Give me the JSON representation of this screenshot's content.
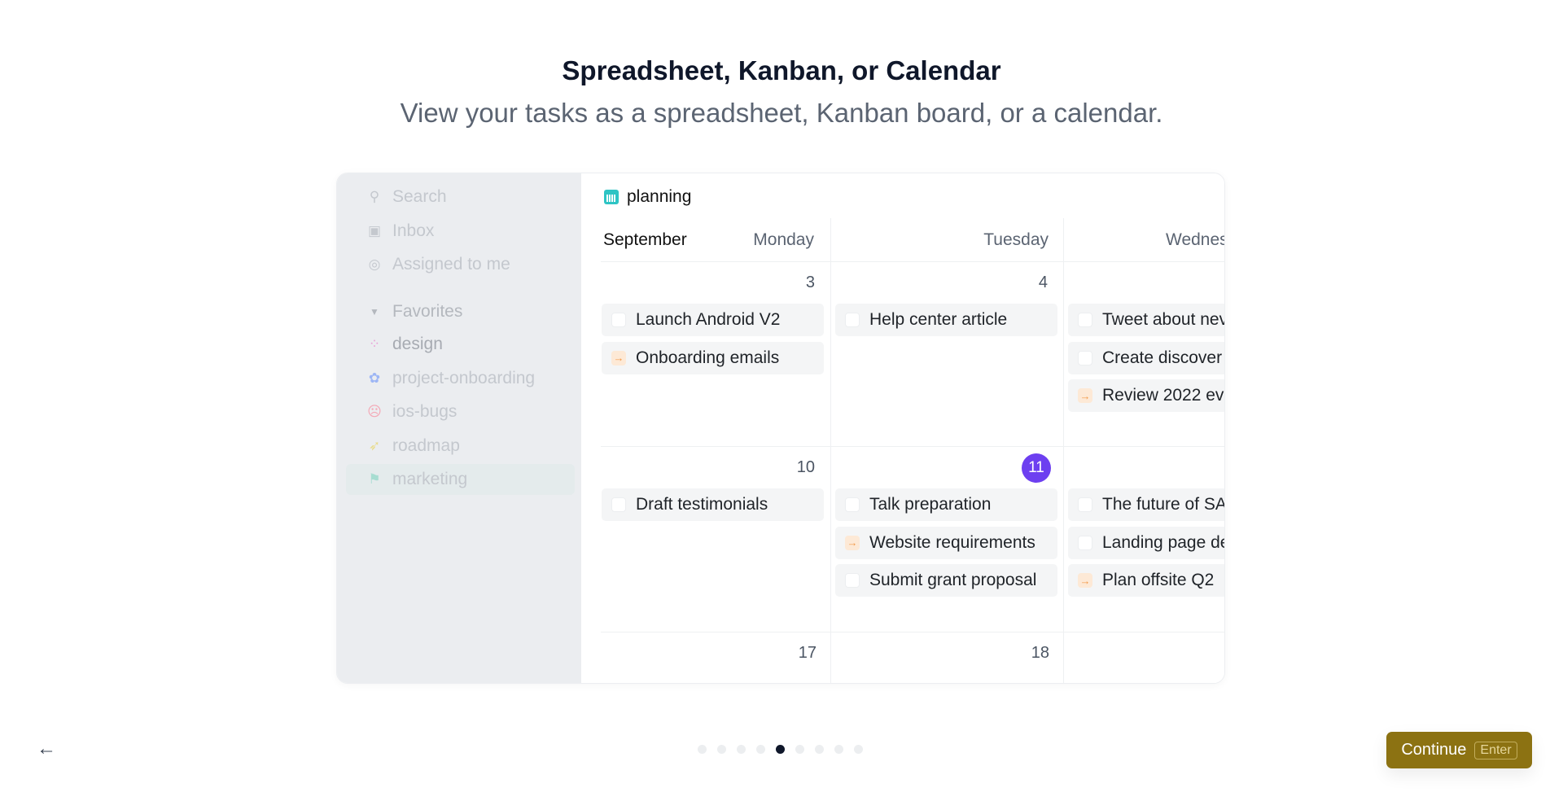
{
  "header": {
    "title": "Spreadsheet, Kanban, or Calendar",
    "subtitle": "View your tasks as a spreadsheet, Kanban board, or a calendar."
  },
  "sidebar": {
    "search": "Search",
    "inbox": "Inbox",
    "assigned": "Assigned to me",
    "favorites": "Favorites",
    "items": [
      {
        "label": "design",
        "icon": "grid-icon",
        "color": "#e9a0d8"
      },
      {
        "label": "project-onboarding",
        "icon": "flower-icon",
        "color": "#9db6f5"
      },
      {
        "label": "ios-bugs",
        "icon": "bug-icon",
        "color": "#f4a7b5"
      },
      {
        "label": "roadmap",
        "icon": "rocket-icon",
        "color": "#e9dc8e"
      },
      {
        "label": "marketing",
        "icon": "flag-icon",
        "color": "#a7ddd1"
      }
    ]
  },
  "calendar": {
    "title": "planning",
    "month": "September",
    "days": [
      "Monday",
      "Tuesday",
      "Wednesd"
    ],
    "weeks": [
      {
        "dates": [
          "3",
          "4",
          ""
        ],
        "tasks": [
          [
            {
              "t": "Launch Android V2",
              "s": "todo"
            },
            {
              "t": "Onboarding emails",
              "s": "progress"
            }
          ],
          [
            {
              "t": "Help center article",
              "s": "todo"
            }
          ],
          [
            {
              "t": "Tweet about nev",
              "s": "todo"
            },
            {
              "t": "Create discover",
              "s": "todo"
            },
            {
              "t": "Review 2022 ev",
              "s": "progress"
            }
          ]
        ]
      },
      {
        "dates": [
          "10",
          "11",
          ""
        ],
        "tasks": [
          [
            {
              "t": "Draft testimonials",
              "s": "todo"
            }
          ],
          [
            {
              "t": "Talk preparation",
              "s": "todo"
            },
            {
              "t": "Website requirements",
              "s": "progress"
            },
            {
              "t": "Submit grant proposal",
              "s": "todo"
            }
          ],
          [
            {
              "t": "The future of SA",
              "s": "todo"
            },
            {
              "t": "Landing page de",
              "s": "todo"
            },
            {
              "t": "Plan offsite Q2",
              "s": "progress"
            }
          ]
        ]
      },
      {
        "dates": [
          "17",
          "18",
          ""
        ],
        "tasks": [
          [],
          [],
          []
        ]
      }
    ],
    "today": "11",
    "today_color": "#6d3ff0"
  },
  "footer": {
    "pages": 9,
    "current_page": 5,
    "continue": "Continue",
    "shortcut": "Enter",
    "accent": "#8c7212"
  }
}
